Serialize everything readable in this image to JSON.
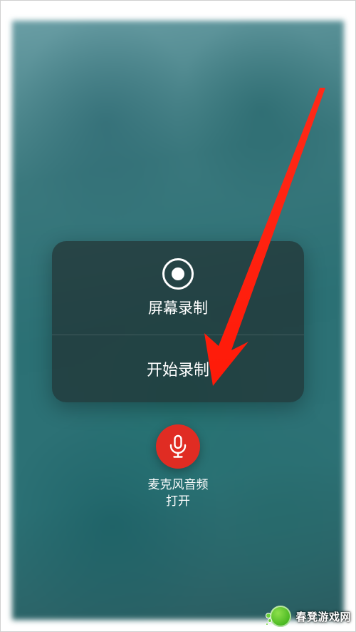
{
  "card": {
    "title": "屏幕录制",
    "start_label": "开始录制"
  },
  "mic": {
    "label_line1": "麦克风音频",
    "label_line2": "打开"
  },
  "watermark": {
    "text": "春凳游戏网"
  }
}
